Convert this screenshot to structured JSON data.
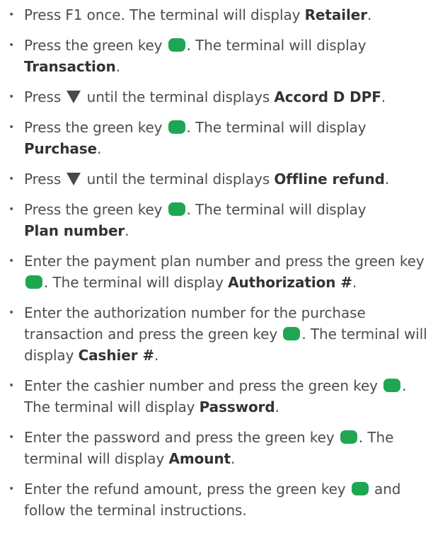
{
  "bullet_char": "•",
  "colors": {
    "text": "#4d4d4d",
    "bold_text": "#333333",
    "green_key": "#1fa653",
    "down_arrow": "#4a4a4a"
  },
  "icons": {
    "green_key": "green-key-icon",
    "down_arrow": "down-arrow-icon"
  },
  "steps": [
    {
      "text_a": "Press F1 once. The terminal will display ",
      "bold": "Retailer",
      "text_b": "."
    },
    {
      "text_a": "Press the green key ",
      "text_b": ". The terminal will display ",
      "bold": "Transaction",
      "text_c": "."
    },
    {
      "text_a": "Press ",
      "text_b": " until the terminal displays ",
      "bold": "Accord D DPF",
      "text_c": "."
    },
    {
      "text_a": "Press the green key ",
      "text_b": ". The terminal will display ",
      "bold": "Purchase",
      "text_c": "."
    },
    {
      "text_a": "Press ",
      "text_b": " until the terminal displays ",
      "bold": "Offline refund",
      "text_c": "."
    },
    {
      "text_a": "Press the green key ",
      "text_b": ". The terminal will display ",
      "bold": "Plan number",
      "text_c": "."
    },
    {
      "text_a": "Enter the payment plan number and press the green key ",
      "text_b": ". The terminal will display ",
      "bold": "Authorization #",
      "text_c": "."
    },
    {
      "text_a": "Enter the authorization number for the purchase transaction and press the green key ",
      "text_b": ". The terminal will display ",
      "bold": "Cashier #",
      "text_c": "."
    },
    {
      "text_a": "Enter the cashier number and press the green key ",
      "text_b": ". The terminal will display ",
      "bold": "Password",
      "text_c": "."
    },
    {
      "text_a": "Enter the password and press the green key ",
      "text_b": ". The terminal will display ",
      "bold": "Amount",
      "text_c": "."
    },
    {
      "text_a": "Enter the refund amount, press the green key ",
      "text_b": " and follow the terminal instructions."
    }
  ]
}
